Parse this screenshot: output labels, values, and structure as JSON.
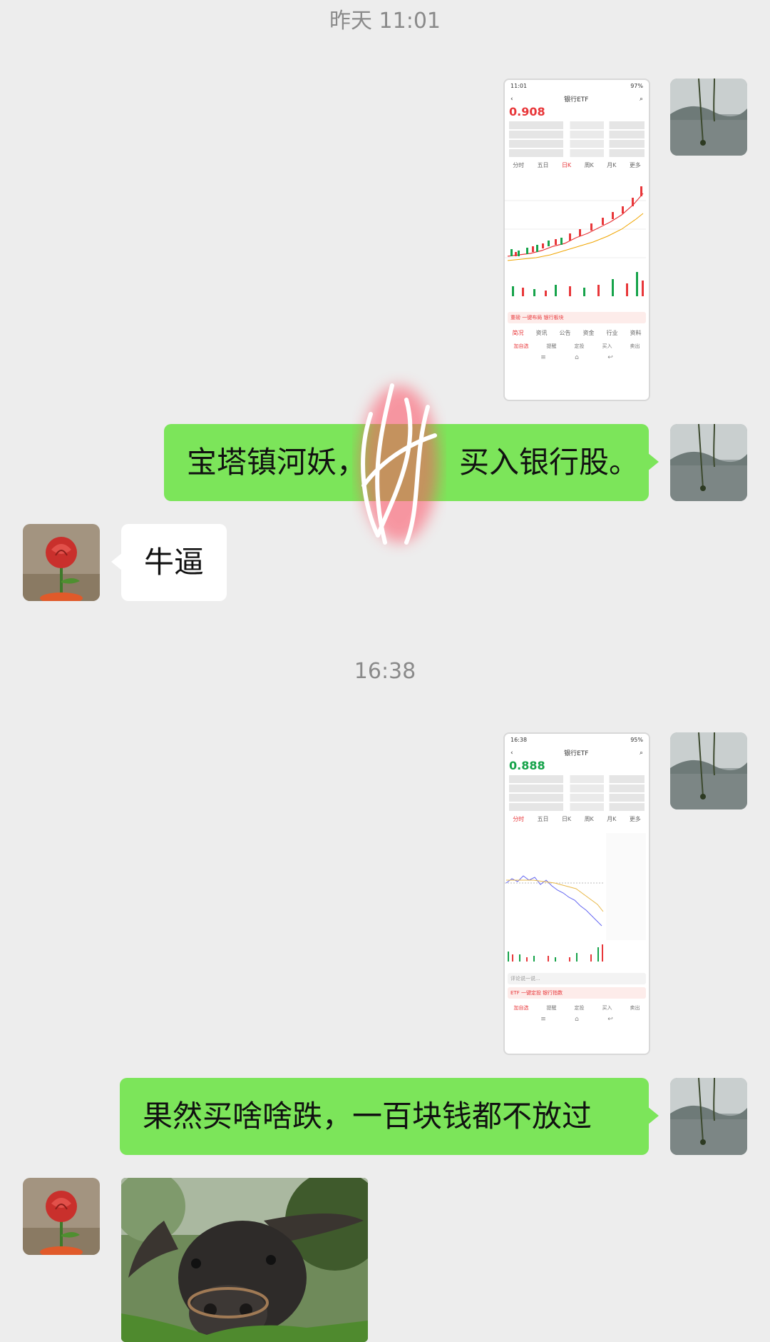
{
  "timestamps": [
    "昨天 11:01",
    "16:38"
  ],
  "messages": {
    "m2_text": "宝塔镇河妖，",
    "m2_text_tail": "买入银行股。",
    "m3_text": "牛逼",
    "m5_text": "果然买啥啥跌，一百块钱都不放过"
  },
  "shot1": {
    "time": "11:01",
    "battery": "97%",
    "title": "银行ETF",
    "price": "0.908",
    "tabs": [
      "分时",
      "五日",
      "日K",
      "周K",
      "月K",
      "更多"
    ],
    "banner": "重磅 一键布局 银行板块",
    "bottom": [
      "简况",
      "资讯",
      "公告",
      "资金",
      "行业",
      "资料"
    ],
    "actions": [
      "加自选",
      "提醒",
      "定投",
      "买入",
      "卖出"
    ]
  },
  "shot2": {
    "time": "16:38",
    "battery": "95%",
    "title": "银行ETF",
    "price": "0.888",
    "tabs": [
      "分时",
      "五日",
      "日K",
      "周K",
      "月K",
      "更多"
    ],
    "banner": "ETF 一键定投 银行指数",
    "bottom": [
      "加自选",
      "提醒",
      "定投",
      "买入",
      "卖出"
    ],
    "search_placeholder": "评论说一说..."
  },
  "colors": {
    "page_bg": "#ededed",
    "bubble_green": "#7ce55a",
    "bubble_white": "#ffffff",
    "stock_red": "#e8373a",
    "stock_green": "#16a34a"
  },
  "icons": [
    "back-icon",
    "share-icon",
    "search-icon",
    "home-icon",
    "menu-icon"
  ]
}
